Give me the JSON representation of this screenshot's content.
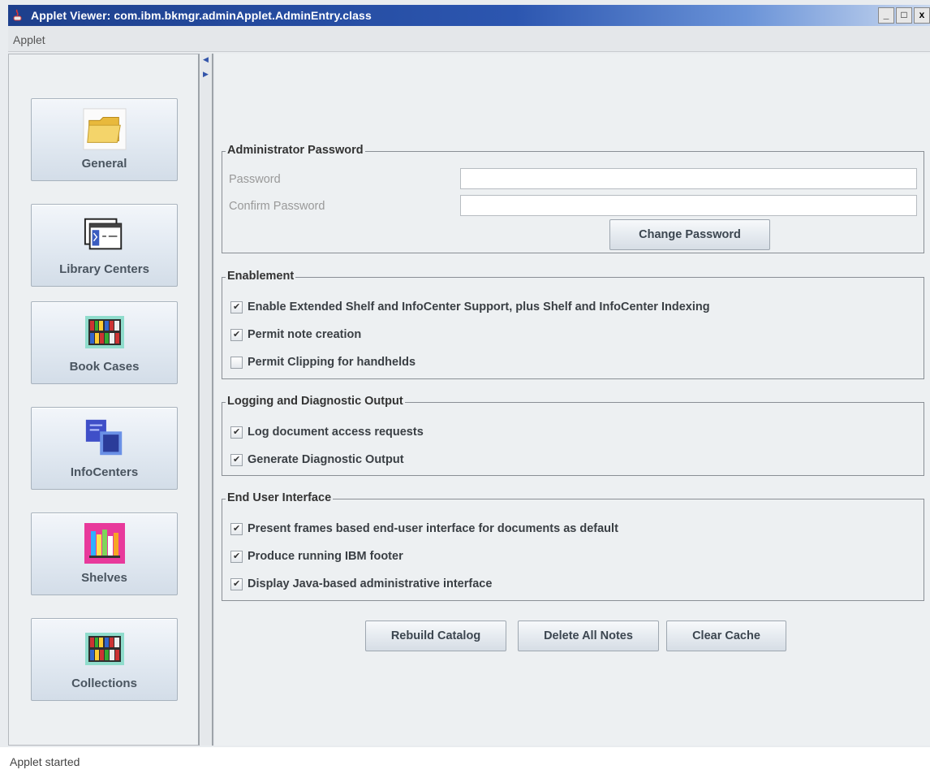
{
  "window": {
    "title": "Applet Viewer: com.ibm.bkmgr.adminApplet.AdminEntry.class",
    "buttons": {
      "minimize": "_",
      "maximize": "□",
      "close": "x"
    }
  },
  "menubar": {
    "items": [
      "Applet"
    ]
  },
  "sidebar": {
    "items": [
      {
        "label": "General",
        "icon": "folder-icon"
      },
      {
        "label": "Library Centers",
        "icon": "library-centers-icon"
      },
      {
        "label": "Book Cases",
        "icon": "bookcase-icon"
      },
      {
        "label": "InfoCenters",
        "icon": "infocenters-icon"
      },
      {
        "label": "Shelves",
        "icon": "shelves-icon"
      },
      {
        "label": "Collections",
        "icon": "collections-icon"
      }
    ]
  },
  "admin_password": {
    "title": "Administrator Password",
    "password_label": "Password",
    "password_value": "",
    "confirm_label": "Confirm Password",
    "confirm_value": "",
    "change_button": "Change Password"
  },
  "enablement": {
    "title": "Enablement",
    "options": [
      {
        "label": "Enable Extended Shelf and InfoCenter Support, plus Shelf and InfoCenter Indexing",
        "checked": true
      },
      {
        "label": "Permit note creation",
        "checked": true
      },
      {
        "label": "Permit Clipping for handhelds",
        "checked": false
      }
    ]
  },
  "logging": {
    "title": "Logging and Diagnostic Output",
    "options": [
      {
        "label": "Log document access requests",
        "checked": true
      },
      {
        "label": "Generate Diagnostic Output",
        "checked": true
      }
    ]
  },
  "end_user": {
    "title": "End User Interface",
    "options": [
      {
        "label": "Present frames based end-user interface for documents as default",
        "checked": true
      },
      {
        "label": "Produce running IBM footer",
        "checked": true
      },
      {
        "label": "Display Java-based administrative interface",
        "checked": true
      }
    ]
  },
  "actions": {
    "rebuild": "Rebuild Catalog",
    "delete_notes": "Delete All Notes",
    "clear_cache": "Clear Cache"
  },
  "status": {
    "text": "Applet started"
  }
}
